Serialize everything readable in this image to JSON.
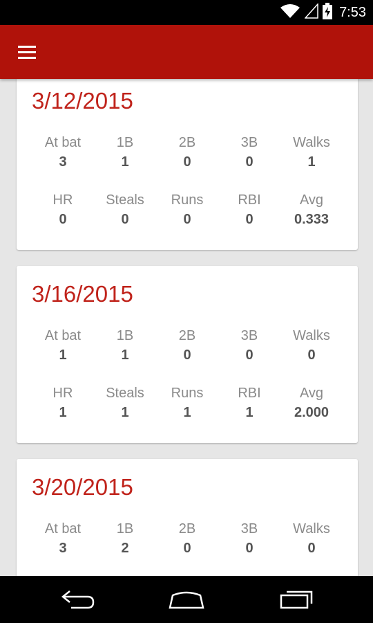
{
  "status_bar": {
    "time": "7:53"
  },
  "icons": {
    "wifi": "wifi-icon",
    "signal": "signal-icon",
    "battery": "battery-charging-icon",
    "menu": "hamburger-menu-icon",
    "back": "back-icon",
    "home": "home-icon",
    "recents": "recents-icon"
  },
  "colors": {
    "app_bar": "#b0120a",
    "date_text": "#c0231b",
    "background": "#e6e6e6"
  },
  "games": [
    {
      "date": "3/12/2015",
      "row1": [
        {
          "label": "At bat",
          "value": "3"
        },
        {
          "label": "1B",
          "value": "1"
        },
        {
          "label": "2B",
          "value": "0"
        },
        {
          "label": "3B",
          "value": "0"
        },
        {
          "label": "Walks",
          "value": "1"
        }
      ],
      "row2": [
        {
          "label": "HR",
          "value": "0"
        },
        {
          "label": "Steals",
          "value": "0"
        },
        {
          "label": "Runs",
          "value": "0"
        },
        {
          "label": "RBI",
          "value": "0"
        },
        {
          "label": "Avg",
          "value": "0.333"
        }
      ]
    },
    {
      "date": "3/16/2015",
      "row1": [
        {
          "label": "At bat",
          "value": "1"
        },
        {
          "label": "1B",
          "value": "1"
        },
        {
          "label": "2B",
          "value": "0"
        },
        {
          "label": "3B",
          "value": "0"
        },
        {
          "label": "Walks",
          "value": "0"
        }
      ],
      "row2": [
        {
          "label": "HR",
          "value": "1"
        },
        {
          "label": "Steals",
          "value": "1"
        },
        {
          "label": "Runs",
          "value": "1"
        },
        {
          "label": "RBI",
          "value": "1"
        },
        {
          "label": "Avg",
          "value": "2.000"
        }
      ]
    },
    {
      "date": "3/20/2015",
      "row1": [
        {
          "label": "At bat",
          "value": "3"
        },
        {
          "label": "1B",
          "value": "2"
        },
        {
          "label": "2B",
          "value": "0"
        },
        {
          "label": "3B",
          "value": "0"
        },
        {
          "label": "Walks",
          "value": "0"
        }
      ],
      "row2": []
    }
  ]
}
